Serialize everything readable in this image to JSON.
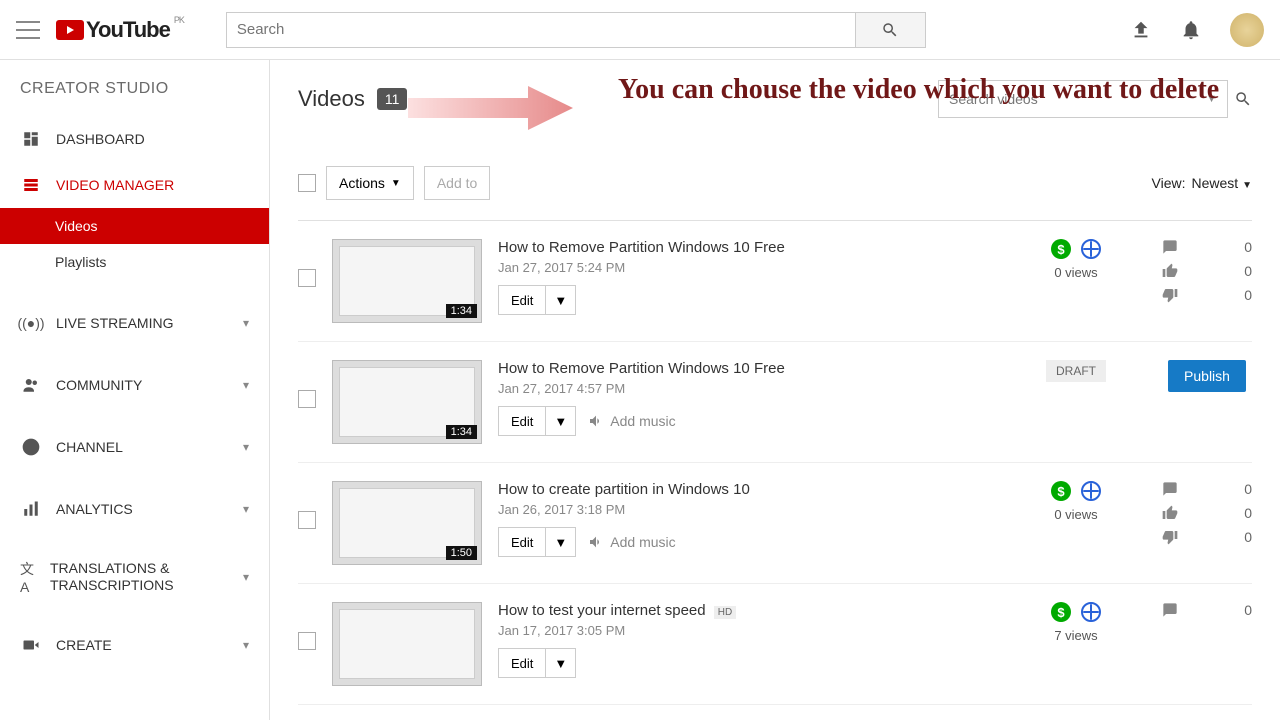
{
  "header": {
    "logo_text": "YouTube",
    "logo_region": "PK",
    "search_placeholder": "Search"
  },
  "sidebar": {
    "title": "CREATOR STUDIO",
    "items": [
      {
        "label": "DASHBOARD"
      },
      {
        "label": "VIDEO MANAGER"
      },
      {
        "label": "LIVE STREAMING"
      },
      {
        "label": "COMMUNITY"
      },
      {
        "label": "CHANNEL"
      },
      {
        "label": "ANALYTICS"
      },
      {
        "label": "TRANSLATIONS & TRANSCRIPTIONS"
      },
      {
        "label": "CREATE"
      }
    ],
    "sub_videos": "Videos",
    "sub_playlists": "Playlists"
  },
  "page": {
    "title": "Videos",
    "count": "11",
    "search_videos": "Search videos",
    "actions": "Actions",
    "add_to": "Add to",
    "view_label": "View:",
    "sort": "Newest",
    "edit": "Edit",
    "add_music": "Add music",
    "publish": "Publish",
    "draft": "DRAFT"
  },
  "annotation": "You can chouse the video which you want to delete",
  "videos": [
    {
      "title": "How to Remove Partition Windows 10 Free",
      "date": "Jan 27, 2017 5:24 PM",
      "duration": "1:34",
      "views": "0 views",
      "comments": "0",
      "likes": "0",
      "dislikes": "0",
      "status": "public",
      "hd": false
    },
    {
      "title": "How to Remove Partition Windows 10 Free",
      "date": "Jan 27, 2017 4:57 PM",
      "duration": "1:34",
      "status": "draft",
      "hd": false,
      "add_music": true
    },
    {
      "title": "How to create partition in Windows 10",
      "date": "Jan 26, 2017 3:18 PM",
      "duration": "1:50",
      "views": "0 views",
      "comments": "0",
      "likes": "0",
      "dislikes": "0",
      "status": "public",
      "hd": false,
      "add_music": true
    },
    {
      "title": "How to test your internet speed",
      "date": "Jan 17, 2017 3:05 PM",
      "duration": "",
      "views": "7 views",
      "comments": "0",
      "status": "public",
      "hd": true
    }
  ]
}
